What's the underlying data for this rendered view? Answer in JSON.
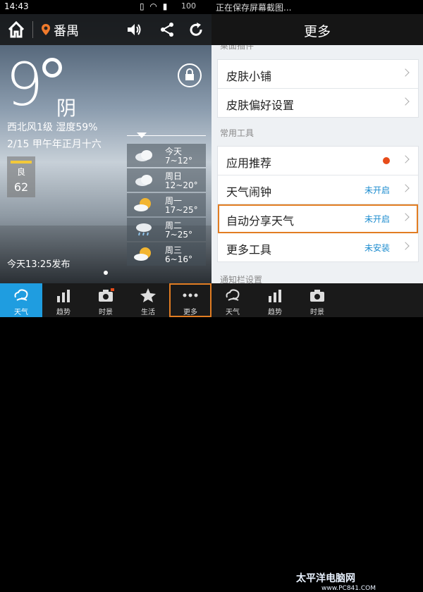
{
  "status_bar": {
    "time": "14:43",
    "battery": "100",
    "notice": "正在保存屏幕截图..."
  },
  "left": {
    "city": "番禺",
    "temperature": "9",
    "condition": "阴",
    "wind_humidity": "西北风1级 湿度59%",
    "date": "2/15 甲午年正月十六",
    "aqi": {
      "level": "良",
      "value": "62"
    },
    "forecast": [
      {
        "day": "今天",
        "temp": "7~12°",
        "icon": "cloudy-icon"
      },
      {
        "day": "周日",
        "temp": "12~20°",
        "icon": "cloudy-icon"
      },
      {
        "day": "周一",
        "temp": "17~25°",
        "icon": "partly-sunny-icon"
      },
      {
        "day": "周二",
        "temp": "7~25°",
        "icon": "rain-icon"
      },
      {
        "day": "周三",
        "temp": "6~16°",
        "icon": "partly-sunny-icon"
      }
    ],
    "publish": "今天13:25发布"
  },
  "right": {
    "title": "更多",
    "section_top_partial": "桌面插件",
    "skin_items": [
      {
        "label": "皮肤小铺"
      },
      {
        "label": "皮肤偏好设置"
      }
    ],
    "tools_header": "常用工具",
    "tools": [
      {
        "label": "应用推荐",
        "status": "",
        "reddot": true
      },
      {
        "label": "天气闹钟",
        "status": "未开启"
      },
      {
        "label": "自动分享天气",
        "status": "未开启",
        "highlight": true
      },
      {
        "label": "更多工具",
        "status": "未安装"
      }
    ],
    "section_bottom_partial": "通知栏设置"
  },
  "tabs_left": [
    {
      "label": "天气",
      "icon": "weather-icon",
      "active": true
    },
    {
      "label": "趋势",
      "icon": "trend-icon"
    },
    {
      "label": "时景",
      "icon": "camera-icon"
    },
    {
      "label": "生活",
      "icon": "star-icon"
    },
    {
      "label": "更多",
      "icon": "more-icon",
      "boxed": true
    }
  ],
  "tabs_right": [
    {
      "label": "天气",
      "icon": "weather-icon"
    },
    {
      "label": "趋势",
      "icon": "trend-icon"
    },
    {
      "label": "时景",
      "icon": "camera-icon"
    }
  ],
  "watermark": {
    "text": "太平洋电脑网",
    "url": "www.PC841.COM"
  },
  "colors": {
    "accent": "#1f9de0",
    "highlight": "#e27d22",
    "status_blue": "#1c8ccf",
    "red_dot": "#e74c1a"
  }
}
